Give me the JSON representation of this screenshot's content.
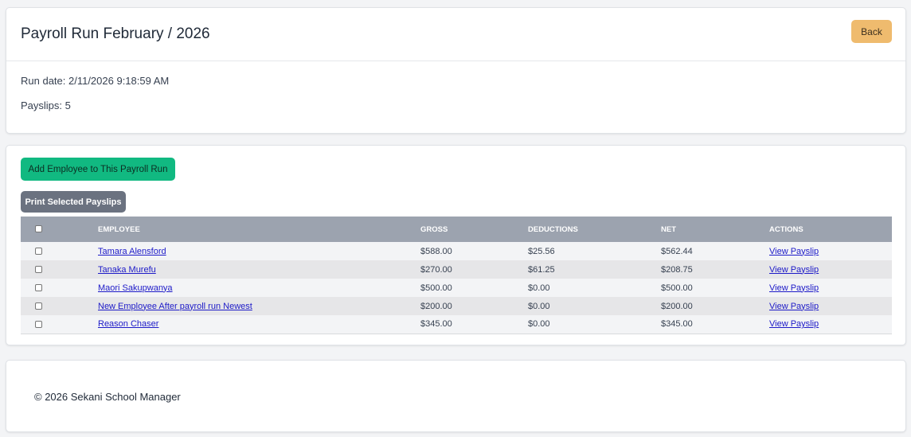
{
  "header": {
    "title": "Payroll Run February / 2026",
    "back_label": "Back",
    "run_date": "Run date: 2/11/2026 9:18:59 AM",
    "payslips": "Payslips: 5"
  },
  "actions": {
    "add_employee_label": "Add Employee to This Payroll Run",
    "print_selected_label": "Print Selected Payslips"
  },
  "table": {
    "columns": [
      "EMPLOYEE",
      "GROSS",
      "DEDUCTIONS",
      "NET",
      "ACTIONS"
    ],
    "rows": [
      {
        "employee": "Tamara Alensford",
        "gross": "$588.00",
        "deductions": "$25.56",
        "net": "$562.44",
        "action": "View Payslip",
        "checked": false
      },
      {
        "employee": "Tanaka Murefu",
        "gross": "$270.00",
        "deductions": "$61.25",
        "net": "$208.75",
        "action": "View Payslip",
        "checked": false
      },
      {
        "employee": "Maori Sakupwanya",
        "gross": "$500.00",
        "deductions": "$0.00",
        "net": "$500.00",
        "action": "View Payslip",
        "checked": false
      },
      {
        "employee": "New Employee After payroll run Newest",
        "gross": "$200.00",
        "deductions": "$0.00",
        "net": "$200.00",
        "action": "View Payslip",
        "checked": false
      },
      {
        "employee": "Reason Chaser",
        "gross": "$345.00",
        "deductions": "$0.00",
        "net": "$345.00",
        "action": "View Payslip",
        "checked": false
      }
    ]
  },
  "footer": {
    "copyright": "© 2026 Sekani School Manager"
  },
  "colors": {
    "back_button": "#efbb6e",
    "add_button": "#11b981",
    "print_button": "#6b7280",
    "table_header": "#9ca3af",
    "link": "#1d1ac8"
  }
}
